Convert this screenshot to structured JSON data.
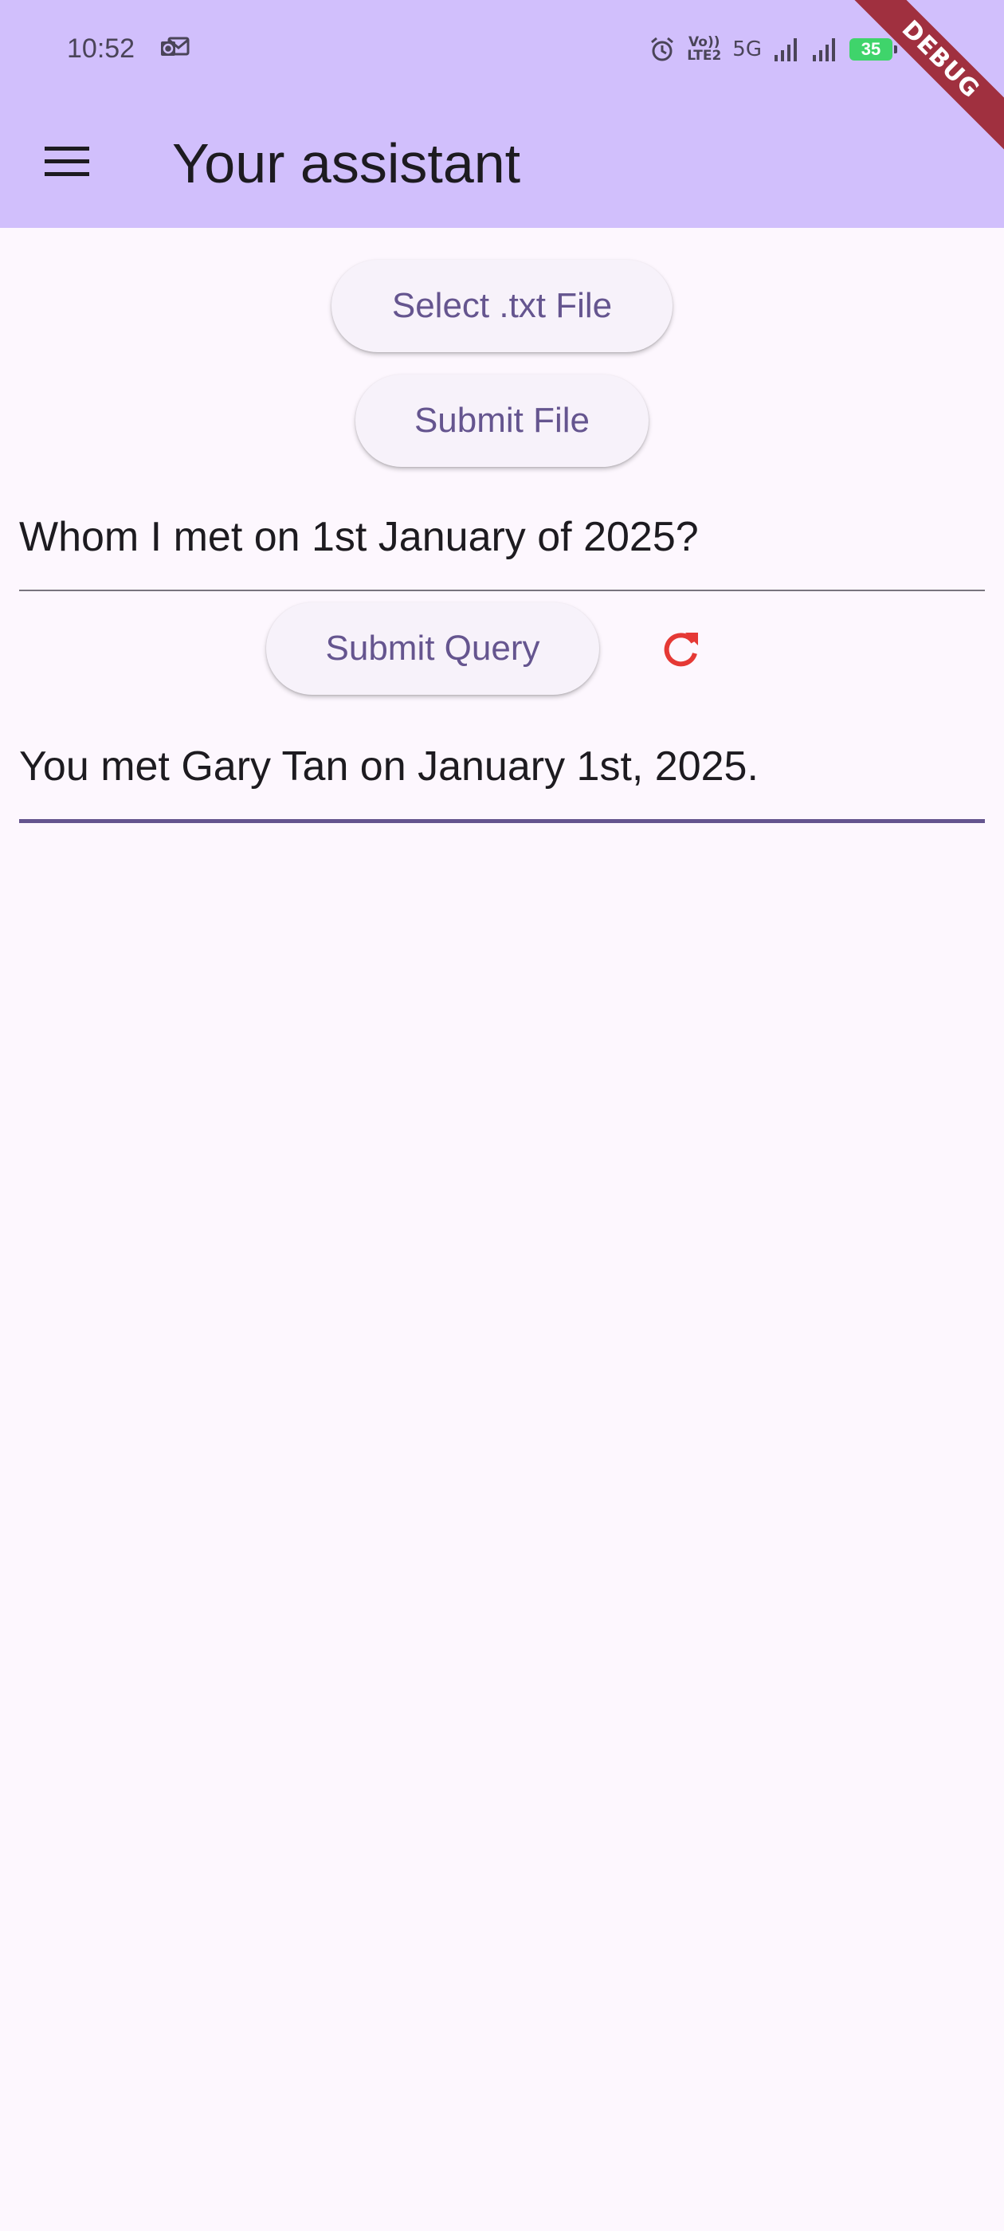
{
  "status_bar": {
    "time": "10:52",
    "notification_icon": "outlook-mail-icon",
    "network_label": "5G",
    "volte_label_top": "Vo))",
    "volte_label_bottom": "LTE2",
    "battery_level": "35"
  },
  "app_bar": {
    "title": "Your assistant",
    "menu_icon": "hamburger-menu-icon"
  },
  "debug_banner": "DEBUG",
  "buttons": {
    "select_file": "Select .txt File",
    "submit_file": "Submit File",
    "submit_query": "Submit Query",
    "refresh_icon": "refresh-icon"
  },
  "query": {
    "value": "Whom I met on 1st January of 2025?"
  },
  "answer": {
    "value": "You met Gary Tan on January 1st, 2025."
  },
  "colors": {
    "app_bar_background": "#d1bffc",
    "page_background": "#fdf7fe",
    "button_text": "#65558f",
    "refresh_icon": "#e53935",
    "debug_ribbon": "#a0303f"
  }
}
